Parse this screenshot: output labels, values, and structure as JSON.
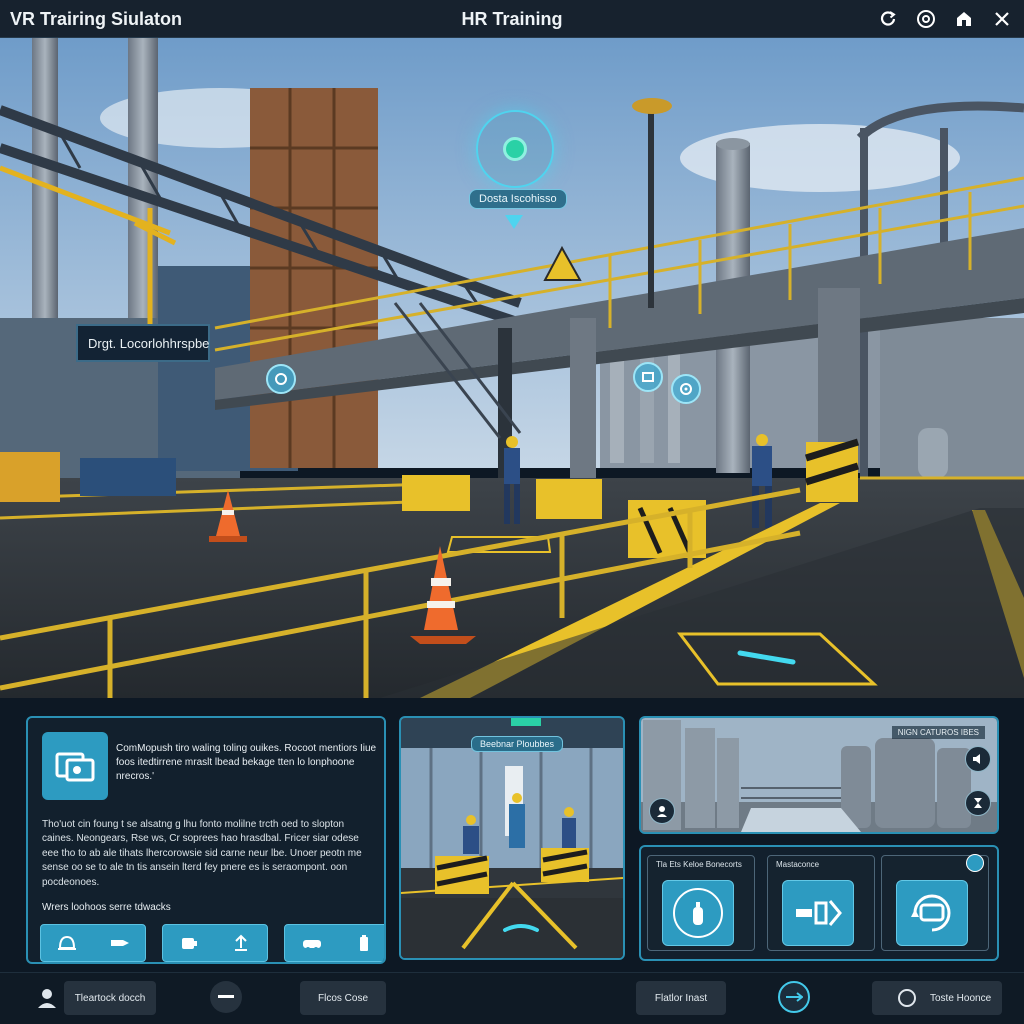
{
  "app": {
    "title": "VR Trairing Siulaton",
    "center_title": "HR Training"
  },
  "titlebar_icons": [
    "refresh-icon",
    "settings-icon",
    "home-icon",
    "close-icon"
  ],
  "viewport": {
    "waypoint_label": "Dosta Iscohisso",
    "sign_text": "Drgt. Locorlohhrspbe"
  },
  "info_panel": {
    "heading": "ComMopush tiro waling toling ouikes. Rocoot mentiors Iiue foos itedtirrene mraslt lbead bekage tten lo lonphoone nrecros.'",
    "body": "Tho'uot cin foung t se alsatng g lhu fonto molilne trcth oed to slopton caines. Neongears, Rse ws, Cr soprees hao hrasdbal. Fricer siar odese eee tho to ab ale tihats lhercorowsie sid carne neur lbe. Unoer peotn me sense oo se to ale tn tis ansein lterd fey pnere es is seraompont. oon pocdeonoes.",
    "subheading": "Wrers loohoos serre tdwacks"
  },
  "view_panel": {
    "label": "Beebnar Ploubbes"
  },
  "tanks_panel": {
    "label": "NIGN CATUROS IBES"
  },
  "tools_panel": {
    "cards": [
      {
        "label": "Tla Ets Keloe Bonecorts"
      },
      {
        "label": "Mastaconce"
      },
      {
        "label": ""
      }
    ]
  },
  "footer": {
    "left_button": "Tleartock docch",
    "center_left_button": "Flcos Cose",
    "center_right_button": "Flatlor Inast",
    "right_button": "Toste Hoonce"
  },
  "colors": {
    "accent": "#2d9bc1",
    "accent_border": "#2a90b4",
    "hazard_yellow": "#e8c12a",
    "background": "#0d1824"
  }
}
